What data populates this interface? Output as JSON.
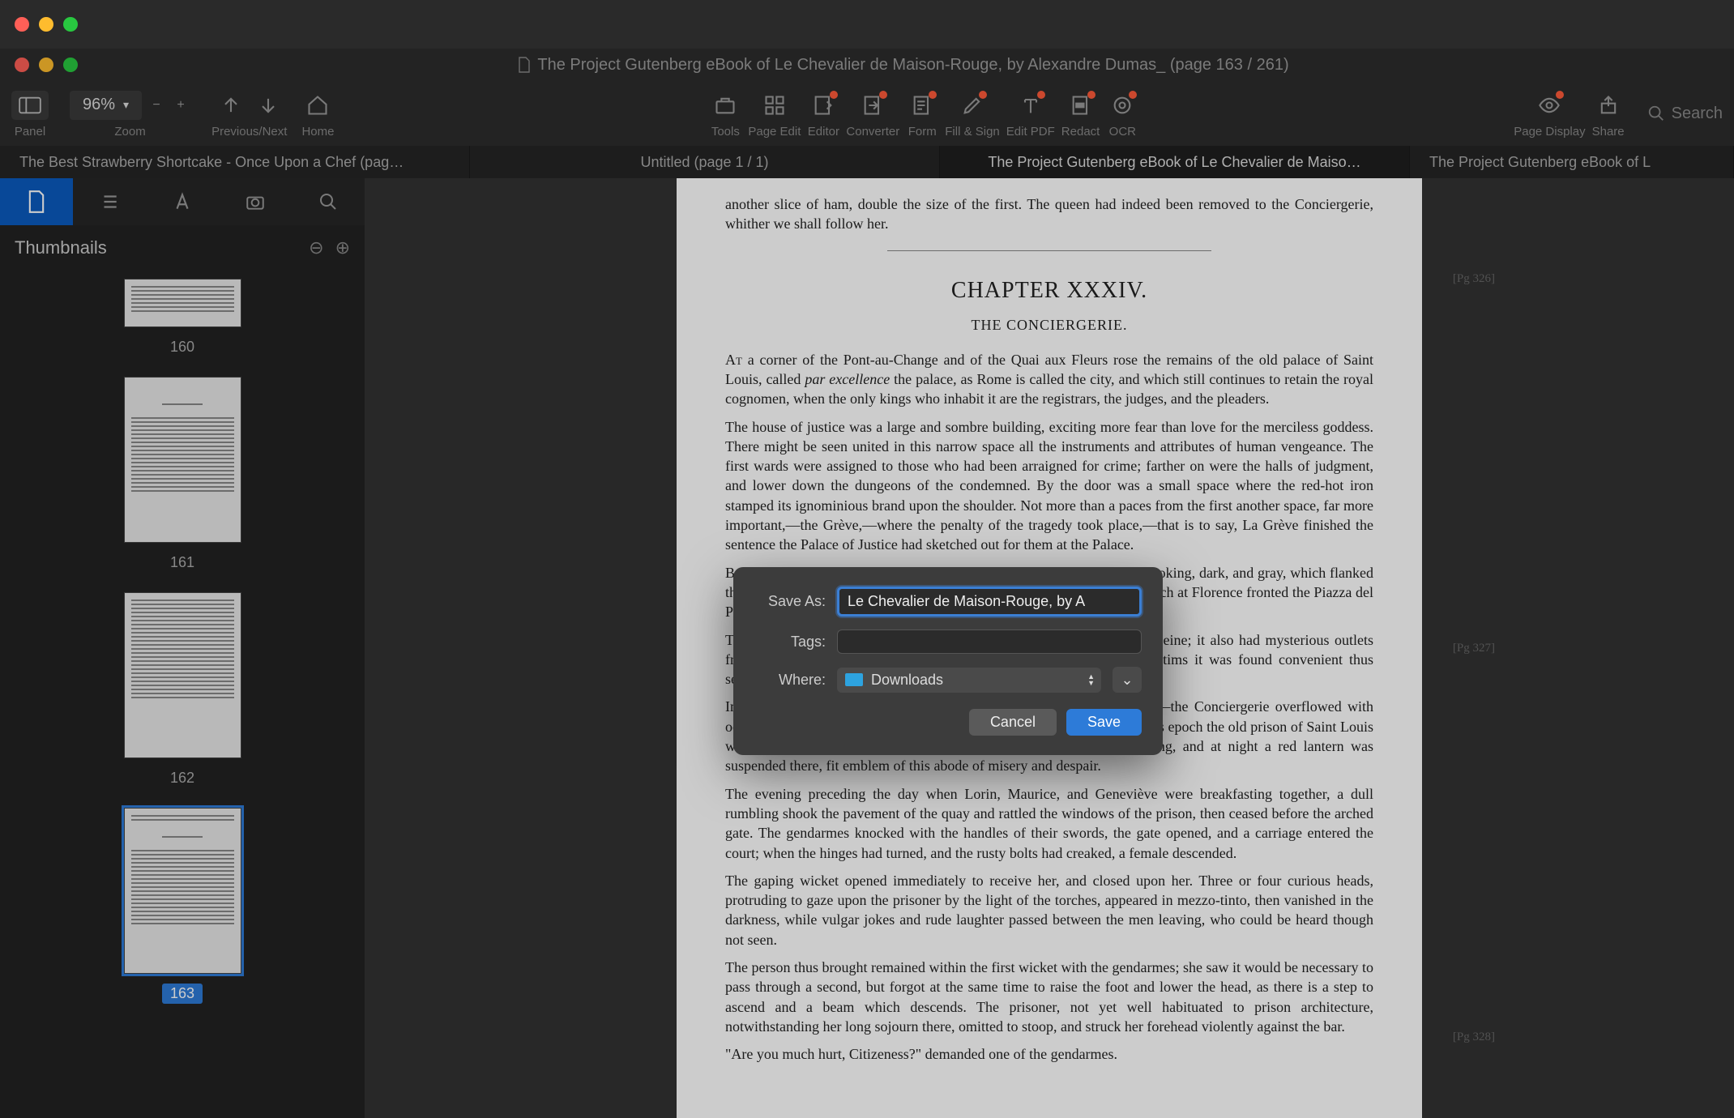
{
  "outer_window": {
    "title": ""
  },
  "window": {
    "title": "The Project Gutenberg eBook of Le Chevalier de Maison-Rouge, by Alexandre Dumas_ (page 163 / 261)"
  },
  "toolbar": {
    "panel_label": "Panel",
    "zoom_value": "96%",
    "zoom_label": "Zoom",
    "prevnext_label": "Previous/Next",
    "home_label": "Home",
    "tools_label": "Tools",
    "pageedit_label": "Page Edit",
    "editor_label": "Editor",
    "converter_label": "Converter",
    "form_label": "Form",
    "fillsign_label": "Fill & Sign",
    "editpdf_label": "Edit PDF",
    "redact_label": "Redact",
    "ocr_label": "OCR",
    "pagedisplay_label": "Page Display",
    "share_label": "Share",
    "search_placeholder": "Search"
  },
  "tabs": [
    {
      "label": "The Best Strawberry Shortcake - Once Upon a Chef (pag…",
      "active": false
    },
    {
      "label": "Untitled (page 1 / 1)",
      "active": false
    },
    {
      "label": "The Project Gutenberg eBook of Le Chevalier de Maiso…",
      "active": true
    },
    {
      "label": "The Project Gutenberg eBook of L",
      "active": false
    }
  ],
  "sidebar": {
    "title": "Thumbnails",
    "thumbs": [
      {
        "num": "160",
        "partial": true
      },
      {
        "num": "161"
      },
      {
        "num": "162"
      },
      {
        "num": "163",
        "selected": true
      }
    ]
  },
  "document": {
    "pg326": "[Pg 326]",
    "pg327": "[Pg 327]",
    "pg328": "[Pg 328]",
    "para_top": "another slice of ham, double the size of the first. The queen had indeed been removed to the Conciergerie, whither we shall follow her.",
    "chapter_title": "CHAPTER XXXIV.",
    "chapter_sub": "THE CONCIERGERIE.",
    "p1_a": "At",
    "p1_b": " a corner of the Pont-au-Change and of the Quai aux Fleurs rose the remains of the old palace of Saint Louis, called ",
    "p1_c": "par excellence",
    "p1_d": " the palace, as Rome is called the city, and which still continues to retain the royal cognomen, when the only kings who inhabit it are the registrars, the judges, and the pleaders.",
    "p2": "The house of justice was a large and sombre building, exciting more fear than love for the merciless goddess. There might be seen united in this narrow space all the instruments and attributes of human vengeance. The first wards were assigned to those who had been arraigned for crime; farther on were the halls of judgment, and lower down the dungeons of the condemned. By the door was a small space where the red-hot iron stamped its ignominious brand upon the shoulder. Not more than a paces from the first another space, far more important,—the Grève,—where the penalty of the tragedy took place,—that is to say, La Grève finished the sentence the Palace of Justice had sketched out for them at the Palace.",
    "p3": "Before the gate opened for the carriages one tower after another, sullen-looking, dark, and gray, which flanked the Quai des Lunettes. These fleecing arches resemble the grated dens which at Florence fronted the Piazza del Palazzo Vecchio. This is the Conciergerie.",
    "p4": "The tower possessed dungeons, which the mud from the waters of the Seine; it also had mysterious outlets from the prison, which were formerly conducted to the river those victims it was found convenient thus secretly to remove.",
    "p5_a": "In 1793, the Conciergerie, the never-failing ",
    "p5_b": "procureur",
    "p5_c": " for the scaffold,—the Conciergerie overflowed with occupants, who within an hour became the victims of the guillotine. At this epoch the old prison of Saint Louis was literally the Inn of Death. Under the arches some gates were hung, and at night a red lantern was suspended there, fit emblem of this abode of misery and despair.",
    "p6": "The evening preceding the day when Lorin, Maurice, and Geneviève were breakfasting together, a dull rumbling shook the pavement of the quay and rattled the windows of the prison, then ceased before the arched gate. The gendarmes knocked with the handles of their swords, the gate opened, and a carriage entered the court; when the hinges had turned, and the rusty bolts had creaked, a female descended.",
    "p7": "The gaping wicket opened immediately to receive her, and closed upon her. Three or four curious heads, protruding to gaze upon the prisoner by the light of the torches, appeared in mezzo-tinto, then vanished in the darkness, while vulgar jokes and rude laughter passed between the men leaving, who could be heard though not seen.",
    "p8": "The person thus brought remained within the first wicket with the gendarmes; she saw it would be necessary to pass through a second, but forgot at the same time to raise the foot and lower the head, as there is a step to ascend and a beam which descends. The prisoner, not yet well habituated to prison architecture, notwithstanding her long sojourn there, omitted to stoop, and struck her forehead violently against the bar.",
    "p9": "\"Are you much hurt, Citizeness?\" demanded one of the gendarmes."
  },
  "dialog": {
    "saveas_label": "Save As:",
    "saveas_value": "Le Chevalier de Maison-Rouge, by A",
    "tags_label": "Tags:",
    "where_label": "Where:",
    "where_value": "Downloads",
    "cancel": "Cancel",
    "save": "Save"
  }
}
